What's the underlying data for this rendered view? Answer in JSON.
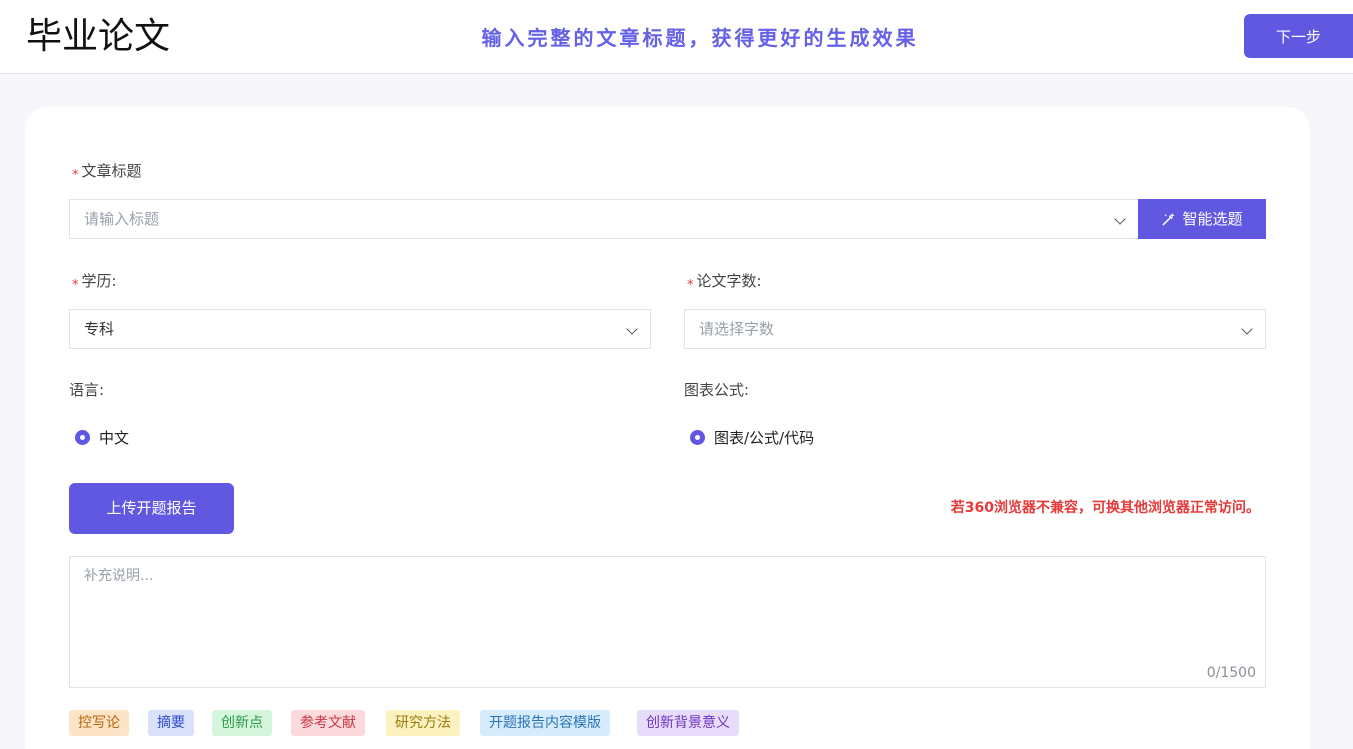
{
  "header": {
    "logo": "毕业论文",
    "tagline": "输入完整的文章标题，获得更好的生成效果",
    "next_label": "下一步"
  },
  "form": {
    "title_label": "文章标题",
    "title_placeholder": "请输入标题",
    "smart_button": "智能选题",
    "education_label": "学历:",
    "education_value": "专科",
    "wordcount_label": "论文字数:",
    "wordcount_placeholder": "请选择字数",
    "language_label": "语言:",
    "language_option": "中文",
    "chart_label": "图表公式:",
    "chart_option": "图表/公式/代码",
    "upload_button": "上传开题报告",
    "browser_warning": "若360浏览器不兼容，可换其他浏览器正常访问。",
    "notes_placeholder": "补充说明...",
    "notes_counter": "0/1500"
  },
  "tags": [
    {
      "label": "控写论",
      "bg": "#fde4c6",
      "fg": "#b9650f"
    },
    {
      "label": "摘要",
      "bg": "#d9e1fb",
      "fg": "#2f4bd6"
    },
    {
      "label": "创新点",
      "bg": "#d5f5dc",
      "fg": "#2a9c45"
    },
    {
      "label": "参考文献",
      "bg": "#fbd9dc",
      "fg": "#c83a44"
    },
    {
      "label": "研究方法",
      "bg": "#fbf2bf",
      "fg": "#9c7a10"
    },
    {
      "label": "开题报告内容模版",
      "bg": "#d6ebfb",
      "fg": "#2a74b8"
    },
    {
      "label": "创新背景意义",
      "bg": "#e8dcfb",
      "fg": "#6a35c0"
    }
  ],
  "colors": {
    "accent": "#6158e1",
    "tagline": "#6461e6",
    "warning": "#e53a3a"
  }
}
